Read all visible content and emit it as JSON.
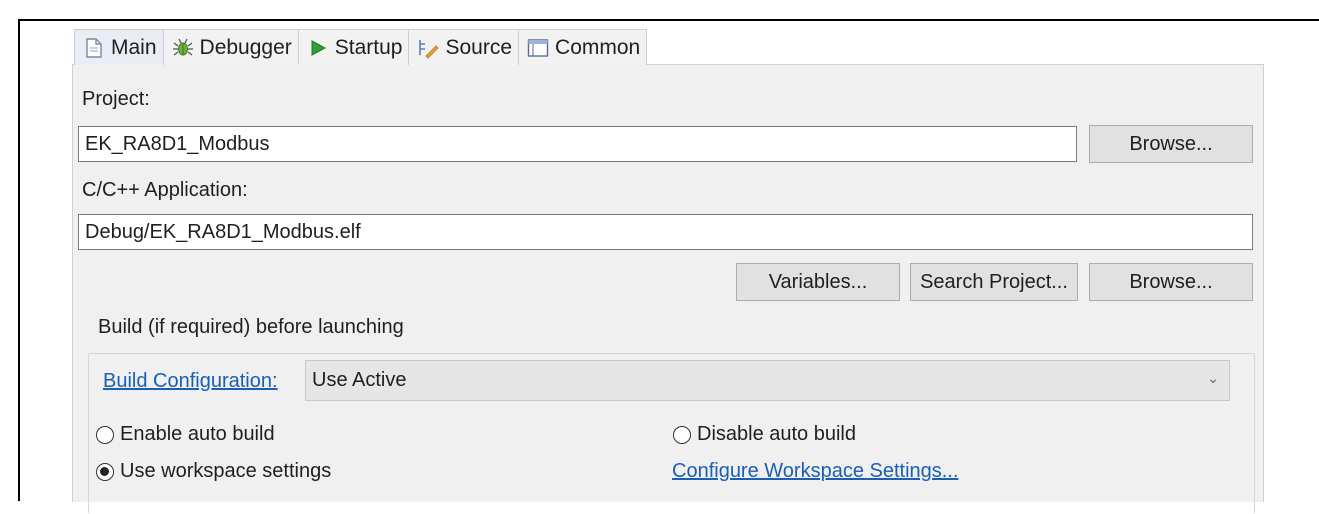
{
  "tabs": [
    {
      "label": "Main",
      "icon": "document-icon",
      "active": true
    },
    {
      "label": "Debugger",
      "icon": "bug-icon"
    },
    {
      "label": "Startup",
      "icon": "play-icon"
    },
    {
      "label": "Source",
      "icon": "source-lookup-icon"
    },
    {
      "label": "Common",
      "icon": "window-icon"
    }
  ],
  "project": {
    "label": "Project:",
    "value": "EK_RA8D1_Modbus",
    "browse_label": "Browse..."
  },
  "application": {
    "label": "C/C++ Application:",
    "value": "Debug/EK_RA8D1_Modbus.elf",
    "variables_label": "Variables...",
    "search_label": "Search Project...",
    "browse_label": "Browse..."
  },
  "build": {
    "group_title": "Build (if required) before launching",
    "config_link": "Build Configuration:",
    "config_value": "Use Active",
    "enable_auto": "Enable auto build",
    "disable_auto": "Disable auto build",
    "use_workspace": "Use workspace settings",
    "configure_link": "Configure Workspace Settings...",
    "selected": "use_workspace"
  },
  "colors": {
    "link": "#1a5fb4",
    "panel_bg": "#f0f0f0",
    "button_bg": "#e1e1e1"
  }
}
